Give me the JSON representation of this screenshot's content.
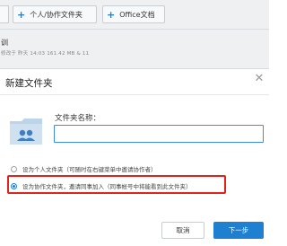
{
  "toolbar": {
    "team_folder_button": "个人/协作文件夹",
    "office_doc_button": "Office文档"
  },
  "background_file": {
    "name": "训",
    "meta": "修改于 昨天 14:03  161.42 MB  &  11"
  },
  "dialog": {
    "title": "新建文件夹",
    "folder_name_label": "文件夹名称：",
    "folder_name_value": "",
    "option_personal": "设为个人文件夹（可随时在右键菜单中邀请协作者）",
    "option_collab": "设为协作文件夹，邀请同事加入（同事帐号中将能看到此文件夹）",
    "selected_option": "collab",
    "cancel_label": "取消",
    "next_label": "下一步"
  },
  "colors": {
    "accent": "#1f7fd1",
    "highlight_border": "#e2231a"
  }
}
